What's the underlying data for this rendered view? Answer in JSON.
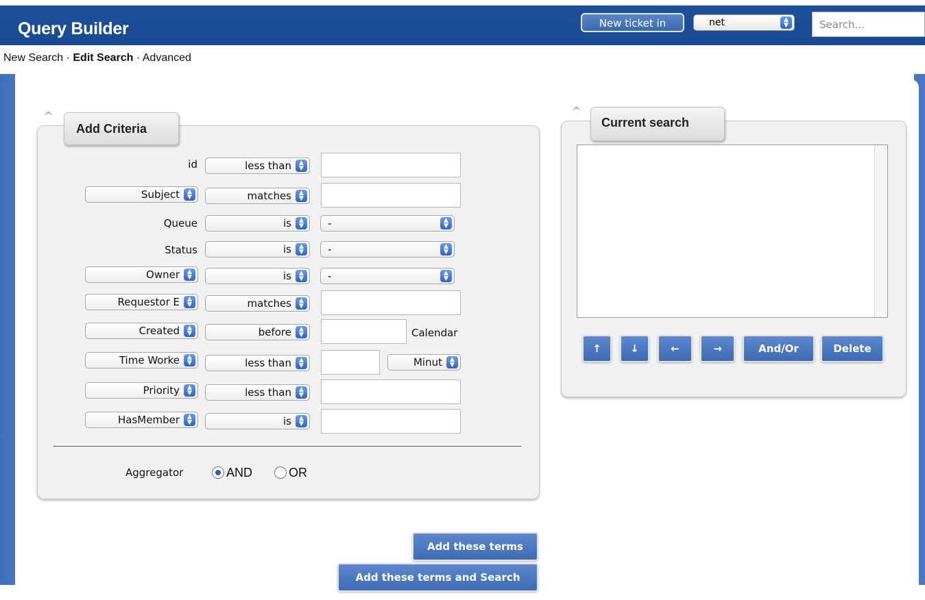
{
  "header": {
    "title": "Query Builder",
    "new_ticket_label": "New ticket in",
    "queue_value": "net",
    "search_placeholder": "Search..."
  },
  "nav": {
    "new_search": "New Search",
    "sep1": " · ",
    "edit_search": "Edit Search",
    "sep2": " · ",
    "advanced": "Advanced"
  },
  "add_criteria": {
    "title": "Add Criteria",
    "rows": [
      {
        "field": "id",
        "op": "less than",
        "value": ""
      },
      {
        "field": "Subject",
        "op": "matches",
        "value": ""
      },
      {
        "field": "Queue",
        "op": "is",
        "value": "-"
      },
      {
        "field": "Status",
        "op": "is",
        "value": "-"
      },
      {
        "field": "Owner",
        "op": "is",
        "value": "-"
      },
      {
        "field": "Requestor E",
        "op": "matches",
        "value": ""
      },
      {
        "field": "Created",
        "op": "before",
        "value": "",
        "extra": "Calendar"
      },
      {
        "field": "Time Worke",
        "op": "less than",
        "value": "",
        "unit": "Minut"
      },
      {
        "field": "Priority",
        "op": "less than",
        "value": ""
      },
      {
        "field": "HasMember",
        "op": "is",
        "value": ""
      }
    ],
    "aggregator_label": "Aggregator",
    "and_label": "AND",
    "or_label": "OR",
    "aggregator_selected": "AND"
  },
  "current_search": {
    "title": "Current search",
    "buttons": {
      "up": "↑",
      "down": "↓",
      "left": "←",
      "right": "→",
      "andor": "And/Or",
      "delete": "Delete"
    }
  },
  "actions": {
    "add_terms": "Add these terms",
    "add_terms_search": "Add these terms and Search"
  },
  "colors": {
    "header_bg": "#1f4f99",
    "button_blue": "#4a78c0",
    "panel_bg": "#f1f1f1"
  }
}
